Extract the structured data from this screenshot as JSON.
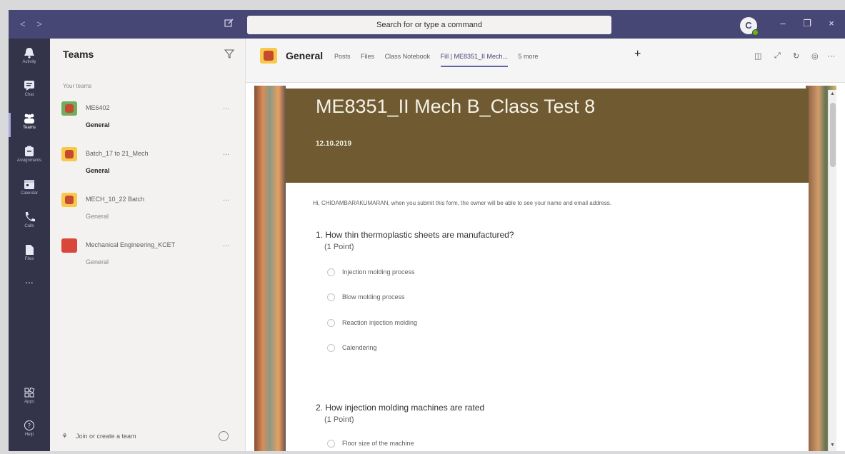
{
  "titlebar": {
    "search_placeholder": "Search for or type a command",
    "avatar_initial": "C",
    "nav_arrows": "< >",
    "minimize": "–",
    "restore": "❐",
    "close": "×"
  },
  "rail": {
    "items": [
      {
        "label": "Activity",
        "icon": "bell-icon"
      },
      {
        "label": "Chat",
        "icon": "chat-icon"
      },
      {
        "label": "Teams",
        "icon": "teams-icon"
      },
      {
        "label": "Assignments",
        "icon": "assignments-icon"
      },
      {
        "label": "Calendar",
        "icon": "calendar-icon"
      },
      {
        "label": "Calls",
        "icon": "phone-icon"
      },
      {
        "label": "Files",
        "icon": "file-icon"
      },
      {
        "label": "...",
        "icon": "more-icon"
      }
    ],
    "apps_label": "Apps",
    "help_label": "Help"
  },
  "teams": {
    "title": "Teams",
    "section_label": "Your teams",
    "list": [
      {
        "name": "ME6402",
        "channel": "General",
        "tile_color": "#6fae5f",
        "bold": true
      },
      {
        "name": "Batch_17 to 21_Mech",
        "channel": "General",
        "tile_color": "#f8c84a",
        "bold": true
      },
      {
        "name": "MECH_10_22 Batch",
        "channel": "General",
        "tile_color": "#f8c84a",
        "bold": false
      },
      {
        "name": "Mechanical Engineering_KCET",
        "channel": "General",
        "tile_color": "#d8473a",
        "bold": false
      }
    ],
    "more_label": "...",
    "join_label": "Join or create a team"
  },
  "channel": {
    "name": "General",
    "tabs": [
      "Posts",
      "Files",
      "Class Notebook",
      "Fill | ME8351_II Mech...",
      "5 more"
    ],
    "active_tab_index": 3,
    "add_tab": "+"
  },
  "form": {
    "title": "ME8351_II Mech B_Class Test 8",
    "date": "12.10.2019",
    "notice": "Hi, CHIDAMBARAKUMARAN, when you submit this form, the owner will be able to see your name and email address.",
    "questions": [
      {
        "text": "1. How thin thermoplastic sheets are manufactured?",
        "points": "(1 Point)",
        "options": [
          "Injection molding process",
          "Blow molding process",
          "Reaction injection molding",
          "Calendering"
        ]
      },
      {
        "text": "2. How injection molding machines are rated",
        "points": "(1 Point)",
        "options": [
          "Floor size of the machine"
        ]
      }
    ]
  },
  "colors": {
    "titlebar": "#464775",
    "rail": "#33344a",
    "banner": "#6f5a32",
    "accent": "#6264a7"
  }
}
